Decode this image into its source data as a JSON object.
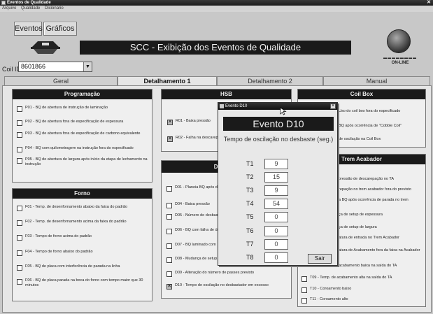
{
  "window": {
    "title": "Eventos de Qualidade"
  },
  "menu": [
    "Arquivo",
    "Qualidade",
    "Dicionario"
  ],
  "top_buttons": {
    "eventos": "Eventos",
    "graficos": "Gráficos"
  },
  "banner": "SCC - Exibição dos Eventos de Qualidade",
  "online_label": "ON-LINE",
  "coil": {
    "label": "Coil ID:",
    "value": "8601866"
  },
  "tabs": [
    "Geral",
    "Detalhamento 1",
    "Detalhamento 2",
    "Manual"
  ],
  "active_tab": "Detalhamento 1",
  "panels": {
    "programacao": {
      "title": "Programação",
      "items": [
        {
          "text": "P01 - BQ de abertura de instrução de laminação",
          "checked": false
        },
        {
          "text": "P02 - BQ de abertura fora de especificação de espessura",
          "checked": false
        },
        {
          "text": "P03 - BQ de abertura fora de especificação de carbono equivalente",
          "checked": false
        },
        {
          "text": "P04 - BQ com quilometragem na instrução fora do especificado",
          "checked": false
        },
        {
          "text": "P05 - BQ de abertura de largura após início da etapa de lechamento na instrução",
          "checked": false
        }
      ]
    },
    "forno": {
      "title": "Forno",
      "items": [
        {
          "text": "F01 - Temp. de desenfornamento abaixo da faixa do padrão",
          "checked": false
        },
        {
          "text": "F02 - Temp. de desenfornamento acima da faixa do padrão",
          "checked": false
        },
        {
          "text": "F03 - Tempo de forno acima do padrão",
          "checked": false
        },
        {
          "text": "F04 - Tempo de forno abaixo do padrão",
          "checked": false
        },
        {
          "text": "F05 - BQ de placa com interferência de parada na linha",
          "checked": false
        },
        {
          "text": "F06 - BQ de placa parada na boca do forno com tempo maior que 30 minutos",
          "checked": false
        }
      ]
    },
    "hsb": {
      "title": "HSB",
      "items": [
        {
          "text": "R01 - Baixa pressão",
          "checked": true
        },
        {
          "text": "R02 - Falha na descarepação",
          "checked": true
        }
      ]
    },
    "desbaste": {
      "title": "Desbaste",
      "items": [
        {
          "text": "D01 - Planeia BQ após desbastador",
          "checked": false
        },
        {
          "text": "D04 - Baixa pressão",
          "checked": false
        },
        {
          "text": "D05 - Número de desbastes diferente do previsto no desbaste",
          "checked": false
        },
        {
          "text": "D06 - BQ com falha de último passe do desbaste",
          "checked": false
        },
        {
          "text": "D07 - BQ laminado com",
          "checked": false
        },
        {
          "text": "D08 - Mudança de setup",
          "checked": false
        },
        {
          "text": "D09 - Alteração do número de passes previsto",
          "checked": false
        },
        {
          "text": "D10 - Tempo de oscilação no desbastador em excesso",
          "checked": true
        }
      ]
    },
    "coilbox": {
      "title": "Coil Box",
      "items": [
        {
          "text": "Uso do coil box fora do especificado",
          "checked": false
        },
        {
          "text": "BQ após ocorrência de \"Cobble Coil\"",
          "checked": false
        },
        {
          "text": "de oscilação na Coil Box",
          "checked": false
        }
      ]
    },
    "trem_acabador": {
      "title": "Trem Acabador",
      "items": [
        {
          "text": "pressão de descarepação no TA",
          "checked": false
        },
        {
          "text": "repação no trem acabador fora do previsto",
          "checked": false
        },
        {
          "text": "a BQ após ocorrência de parada no trem",
          "checked": false
        },
        {
          "text": "ça de setup de espessura",
          "checked": false
        },
        {
          "text": "ça de setup de largura",
          "checked": false
        },
        {
          "text": "atura de entrada no Trem Acabador",
          "checked": false
        },
        {
          "text": "atura de Acabamento fora da faixa na Acabador",
          "checked": false
        },
        {
          "text": "acabamento baixa na saída do TA",
          "checked": false
        },
        {
          "text": "T09 - Temp. de acabamento alta na saída do TA",
          "checked": false
        },
        {
          "text": "T10 - Coroamento baixo",
          "checked": false
        },
        {
          "text": "T11 - Coroamento alto",
          "checked": false
        }
      ]
    }
  },
  "dialog": {
    "title": "Evento D10",
    "heading": "Evento D10",
    "subtitle": "Tempo de oscilação no desbaste (seg.)",
    "fields": [
      {
        "label": "T1",
        "value": "9"
      },
      {
        "label": "T2",
        "value": "15"
      },
      {
        "label": "T3",
        "value": "9"
      },
      {
        "label": "T4",
        "value": "54"
      },
      {
        "label": "T5",
        "value": "0"
      },
      {
        "label": "T6",
        "value": "0"
      },
      {
        "label": "T7",
        "value": "0"
      },
      {
        "label": "T8",
        "value": "0"
      }
    ],
    "close_button": "Sair"
  },
  "icons": [
    "window-icon",
    "close-icon",
    "logo-icon",
    "online-coin-icon",
    "dropdown-arrow-icon",
    "cursor-icon"
  ]
}
